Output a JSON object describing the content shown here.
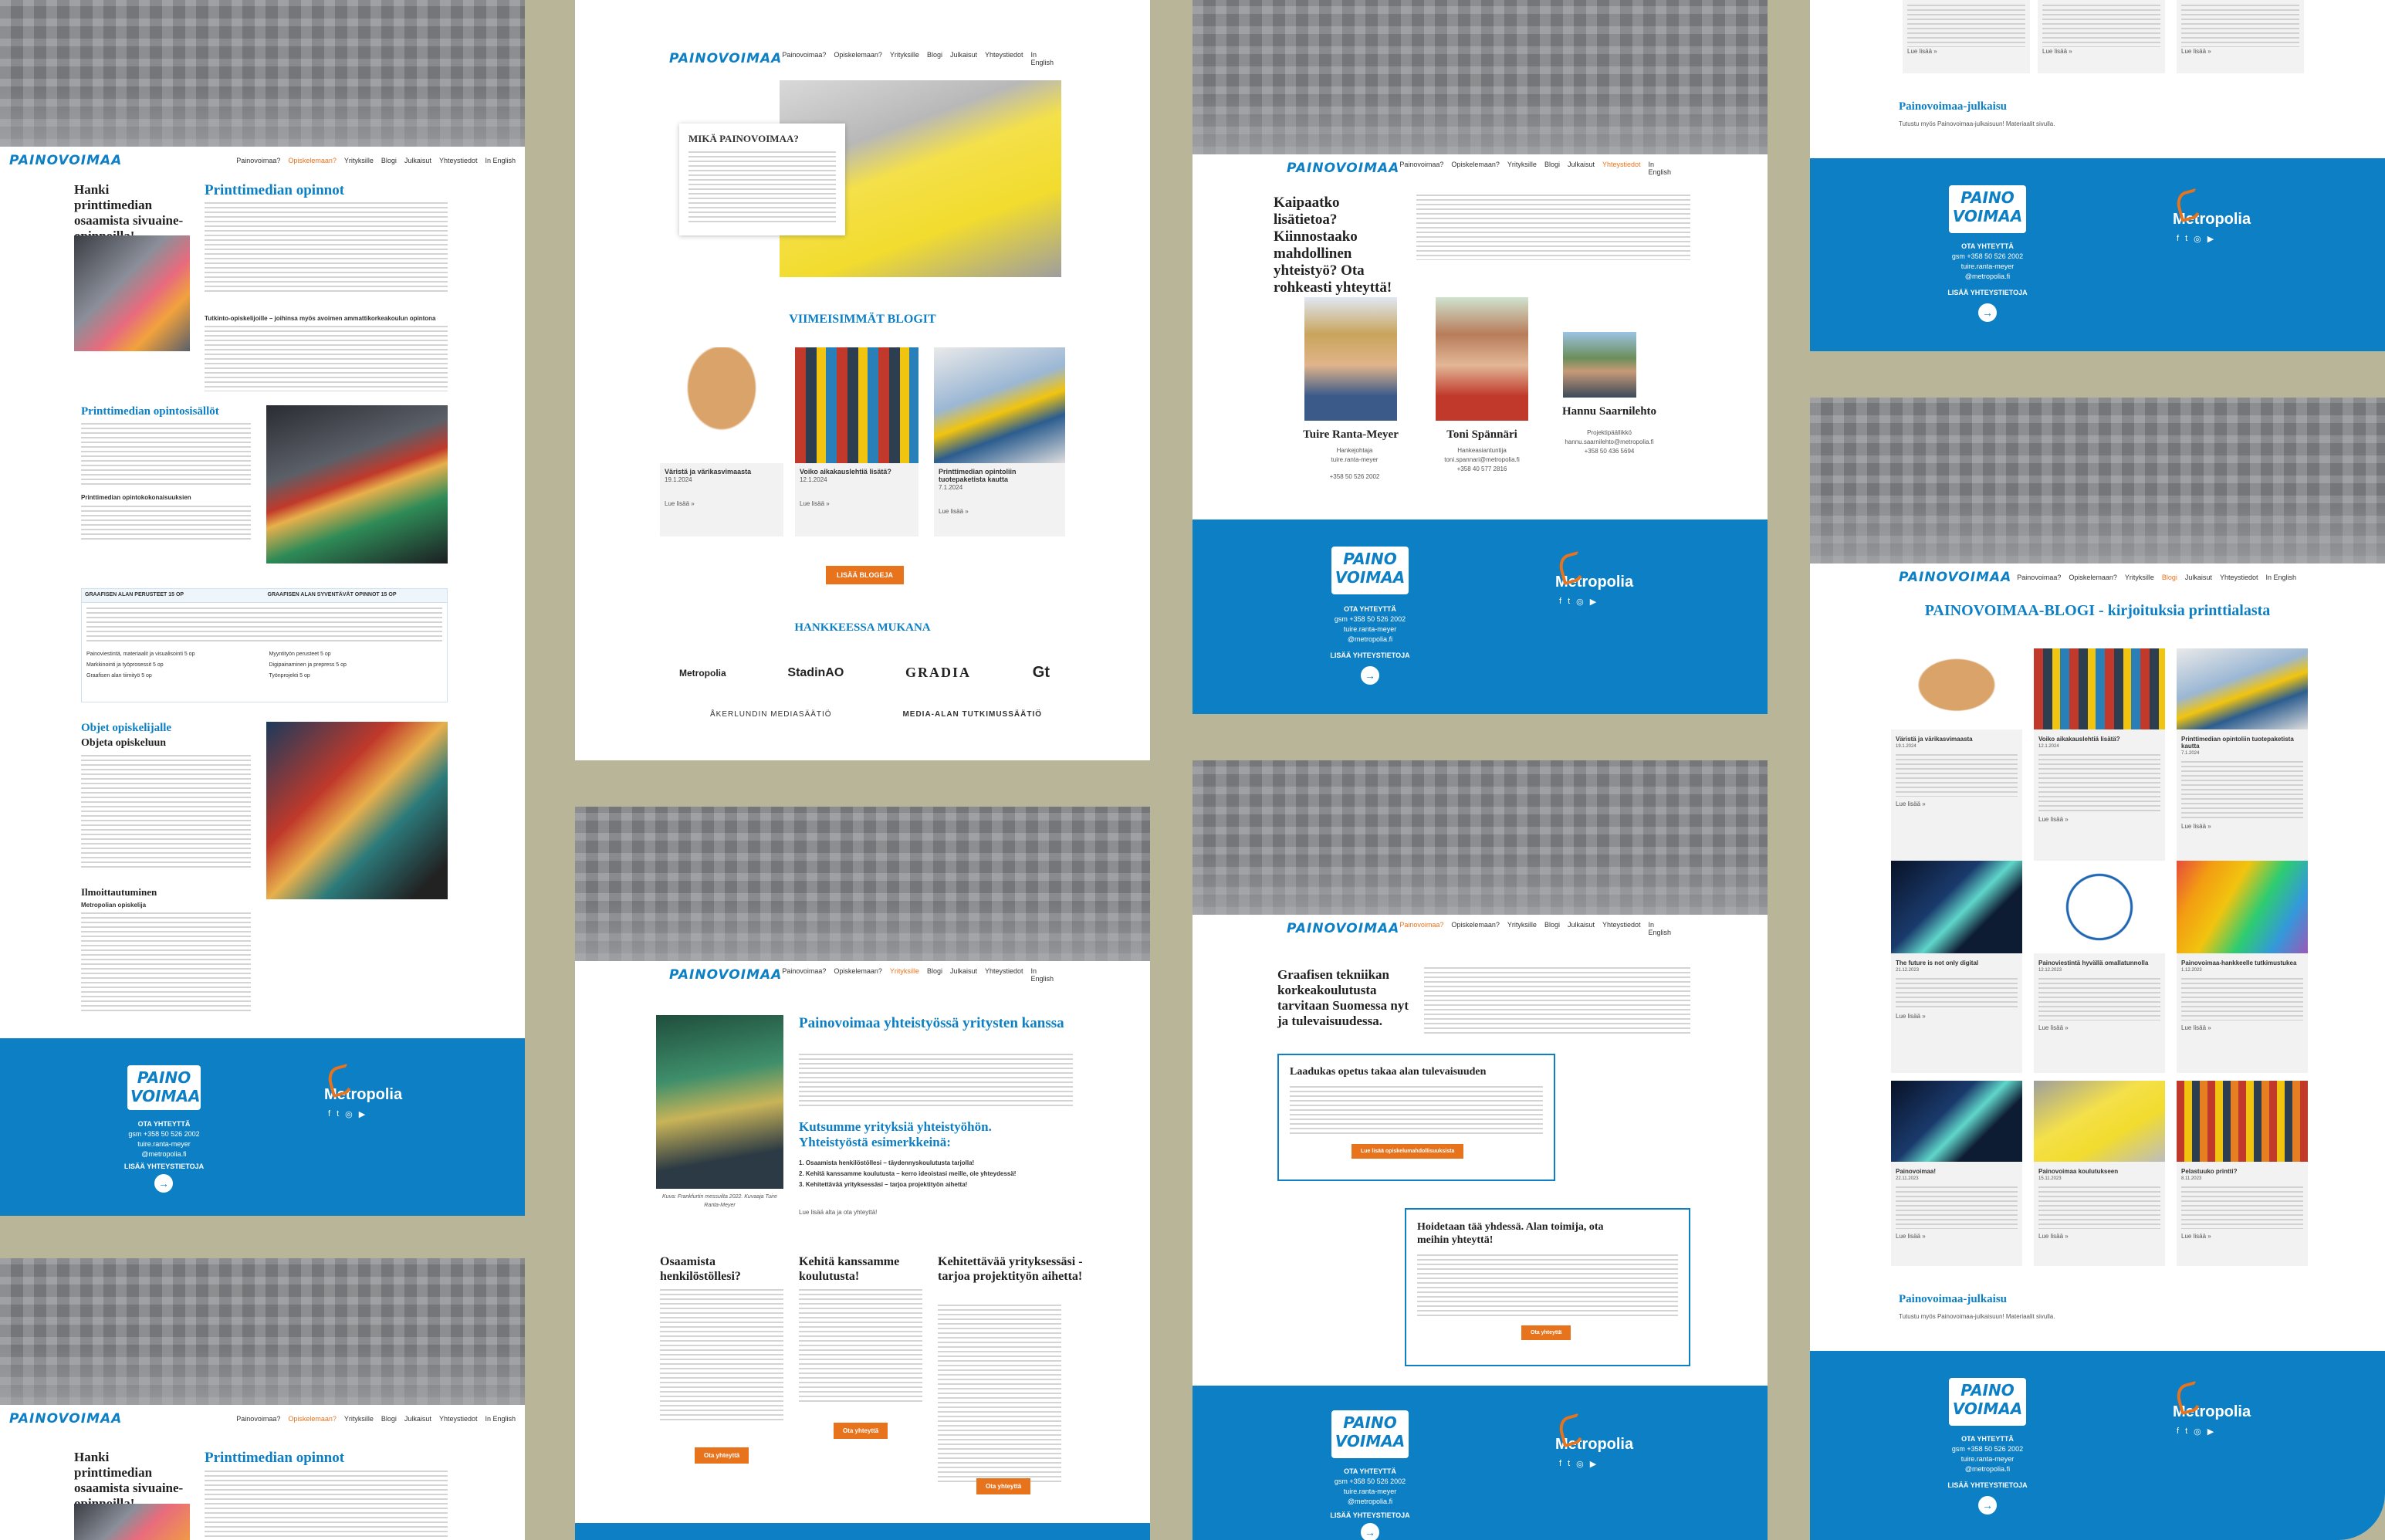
{
  "brand": {
    "logo": "PAINOVOIMAA",
    "logo_top": "PAINO",
    "logo_bottom": "VOIMAA",
    "metropolia": "Metropolia"
  },
  "nav": {
    "items": [
      "Painovoimaa?",
      "Opiskelemaan?",
      "Yrityksille",
      "Blogi",
      "Julkaisut",
      "Yhteystiedot",
      "In English"
    ]
  },
  "p1": {
    "title": "Hanki printtimedian osaamista sivuaine-opinnoilla!",
    "heading": "Printtimedian opinnot",
    "sub1": "Tutkinto-opiskelijoille – joihinsa myös avoimen ammattikorkeakoulun opintona",
    "sec2": "Printtimedian opintosisällöt",
    "sec2sub": "Printtimedian opintokokonaisuuksien",
    "tbl_h1": "GRAAFISEN ALAN PERUSTEET 15 OP",
    "tbl_h2": "GRAAFISEN ALAN SYVENTÄVÄT OPINNOT 15 OP",
    "tbl_rows_l": [
      "Painoviestintä, materiaalit ja visualisointi 5 op",
      "Markkinointi ja työprosessit 5 op",
      "Graafisen alan tiimityö 5 op"
    ],
    "tbl_rows_r": [
      "Myyntityön perusteet 5 op",
      "Digipainaminen ja prepress 5 op",
      "Työnprojekti 5 op"
    ],
    "sec3": "Objet opiskelijalle",
    "sec3b": "Objeta opiskeluun",
    "sec4": "Ilmoittautuminen",
    "sec4sub": "Metropolian opiskelija"
  },
  "p2": {
    "about_title": "MIKÄ PAINOVOIMAA?",
    "blogs_title": "VIIMEISIMMÄT BLOGIT",
    "blogs": [
      {
        "title": "Väristä ja värikasvimaasta",
        "date": "19.1.2024"
      },
      {
        "title": "Voiko aikakauslehtiä lisätä?",
        "date": "12.1.2024"
      },
      {
        "title": "Printtimedian opintoliin tuotepaketista kautta",
        "date": "7.1.2024"
      }
    ],
    "more": "Lue lisää »",
    "btn": "LISÄÄ BLOGEJA",
    "partners_title": "HANKKEESSA MUKANA",
    "partners": [
      "Metropolia",
      "StadinAO",
      "GRADIA",
      "Gt",
      "ÅKERLUNDIN MEDIASÄÄTIÖ",
      "MEDIA-ALAN TUTKIMUSSÄÄTIÖ"
    ]
  },
  "p3": {
    "title": "Kaipaatko lisätietoa? Kiinnostaako mahdollinen yhteistyö? Ota rohkeasti yhteyttä!",
    "people": [
      {
        "name": "Tuire Ranta-Meyer",
        "role": "Hankejohtaja",
        "email": "tuire.ranta-meyer",
        "phone": "+358 50 526 2002"
      },
      {
        "name": "Toni Spännäri",
        "role": "Hankeasiantuntija",
        "email": "toni.spannari@metropolia.fi",
        "phone": "+358 40 577 2816"
      },
      {
        "name": "Hannu Saarnilehto",
        "role": "Projektipäällikkö",
        "email": "hannu.saarnilehto@metropolia.fi",
        "phone": "+358 50 436 5694"
      }
    ]
  },
  "p4": {
    "title": "Painovoimaa yhteistyössä yritysten kanssa",
    "sub": "Kutsumme yrityksiä yhteistyöhön. Yhteistyöstä esimerkkeinä:",
    "list": [
      "1. Osaamista henkilöstöllesi – täydennyskoulutusta tarjolla!",
      "2. Kehitä kanssamme koulutusta – kerro ideoistasi meille, ole yhteydessä!",
      "3. Kehitettävää yrityksessäsi – tarjoa projektityön aihetta!"
    ],
    "read": "Lue lisää alta ja ota yhteyttä!",
    "caption": "Kuva: Frankfurtin messuilta 2022. Kuvaaja Tuire Ranta-Meyer",
    "cols": [
      "Osaamista henkilöstöllesi?",
      "Kehitä kanssamme koulutusta!",
      "Kehitettävää yrityksessäsi - tarjoa projektityön aihetta!"
    ],
    "btn": "Ota yhteyttä"
  },
  "p5": {
    "title": "Graafisen tekniikan korkeakoulutusta tarvitaan Suomessa nyt ja tulevaisuudessa.",
    "box1_title": "Laadukas opetus takaa alan tulevaisuuden",
    "box1_btn": "Lue lisää opiskelumahdollisuuksista",
    "box2_title": "Hoidetaan tää yhdessä. Alan toimija, ota meihin yhteyttä!",
    "box2_btn": "Ota yhteyttä"
  },
  "p6": {
    "title": "PAINOVOIMAA-BLOGI - kirjoituksia printtialasta",
    "posts": [
      {
        "title": "Väristä ja värikasvimaasta",
        "date": "19.1.2024"
      },
      {
        "title": "Voiko aikakauslehtiä lisätä?",
        "date": "12.1.2024"
      },
      {
        "title": "Printtimedian opintoliin tuotepaketista kautta",
        "date": "7.1.2024"
      },
      {
        "title": "The future is not only digital",
        "date": "21.12.2023"
      },
      {
        "title": "Painoviestintä hyvällä omallatunnolla",
        "date": "12.12.2023"
      },
      {
        "title": "Painovoimaa-hankkeelle tutkimustukea",
        "date": "1.12.2023"
      },
      {
        "title": "Painovoimaa!",
        "date": "22.11.2023"
      },
      {
        "title": "Painovoimaa koulutukseen",
        "date": "15.11.2023"
      },
      {
        "title": "Pelastuuko printti?",
        "date": "8.11.2023"
      }
    ],
    "publ": "Painovoimaa-julkaisu",
    "publ_text": "Tutustu myös Painovoimaa-julkaisuun! Materiaalit sivulla.",
    "more": "Lue lisää »",
    "top_publ": "Painovoimaa-julkaisu",
    "top_text": "Tutustu myös Painovoimaa-julkaisuun! Materiaalit sivulla."
  },
  "footer": {
    "contact": "OTA YHTEYTTÄ",
    "person": "Tuire Ranta-Meyer",
    "phone": "gsm +358 50 526 2002",
    "email1": "tuire.ranta-meyer",
    "email2": "@metropolia.fi",
    "more": "LISÄÄ YHTEYSTIETOJA"
  },
  "colors": {
    "brand_blue": "#0c7fc5",
    "accent_orange": "#e8731d",
    "background": "#b9b599"
  }
}
